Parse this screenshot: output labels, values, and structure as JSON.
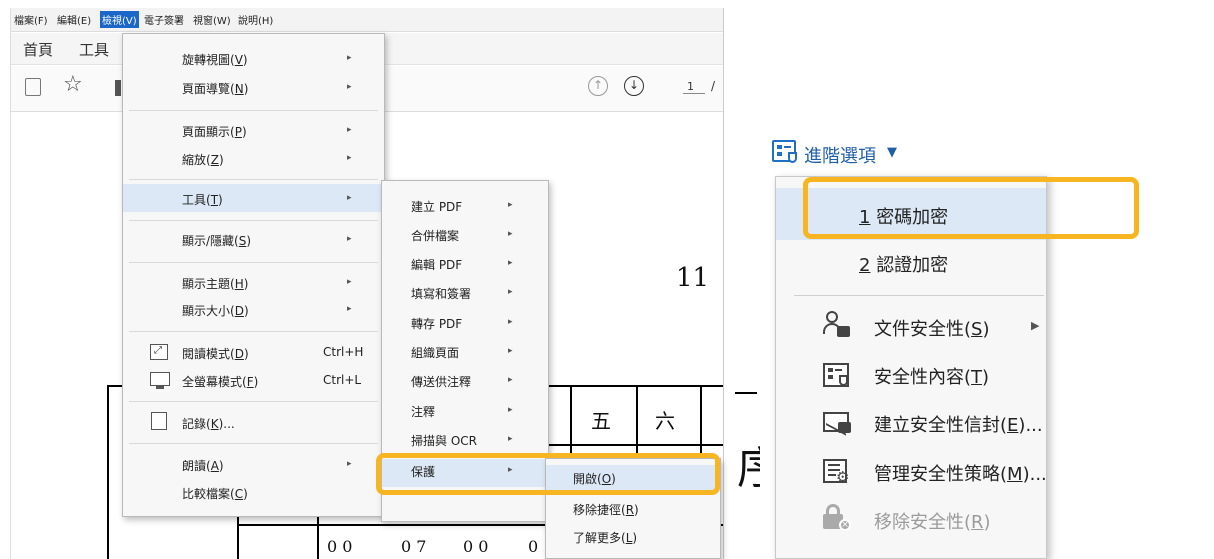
{
  "menubar": {
    "items": [
      "檔案(F)",
      "編輯(E)",
      "檢視(V)",
      "電子簽署",
      "視窗(W)",
      "說明(H)"
    ]
  },
  "tabs": {
    "home": "首頁",
    "tools": "工具"
  },
  "toolbar": {
    "page_number": "1",
    "page_sep": "/"
  },
  "document": {
    "title_fragment": "11",
    "cells": [
      "五",
      "六"
    ],
    "side_char": "序",
    "bottom_nums": [
      "0 0",
      "0 7",
      "0 0",
      "0"
    ]
  },
  "view_menu": {
    "items": [
      {
        "label": "旋轉視圖",
        "key": "V",
        "submenu": true
      },
      {
        "label": "頁面導覽",
        "key": "N",
        "submenu": true
      },
      {
        "label": "頁面顯示",
        "key": "P",
        "submenu": true
      },
      {
        "label": "縮放",
        "key": "Z",
        "submenu": true
      },
      {
        "label": "工具",
        "key": "T",
        "submenu": true
      },
      {
        "label": "顯示/隱藏",
        "key": "S",
        "submenu": true
      },
      {
        "label": "顯示主題",
        "key": "H",
        "submenu": true
      },
      {
        "label": "顯示大小",
        "key": "D",
        "submenu": true
      },
      {
        "label": "閱讀模式",
        "key": "D",
        "shortcut": "Ctrl+H"
      },
      {
        "label": "全螢幕模式",
        "key": "F",
        "shortcut": "Ctrl+L"
      },
      {
        "label": "記錄",
        "key": "K",
        "suffix": "..."
      },
      {
        "label": "朗讀",
        "key": "A",
        "submenu": true
      },
      {
        "label": "比較檔案",
        "key": "C"
      }
    ]
  },
  "tools_submenu": {
    "items": [
      "建立 PDF",
      "合併檔案",
      "編輯 PDF",
      "填寫和簽署",
      "轉存 PDF",
      "組織頁面",
      "傳送供注釋",
      "注釋",
      "掃描與 OCR",
      "保護"
    ]
  },
  "protect_submenu": {
    "items": [
      {
        "label": "開啟",
        "key": "O"
      },
      {
        "label": "移除捷徑",
        "key": "R"
      },
      {
        "label": "了解更多",
        "key": "L"
      }
    ]
  },
  "advanced_panel": {
    "header": "進階選項",
    "items": [
      {
        "num": "1",
        "label": "密碼加密"
      },
      {
        "num": "2",
        "label": "認證加密"
      },
      {
        "label": "文件安全性",
        "key": "S",
        "submenu": true
      },
      {
        "label": "安全性內容",
        "key": "T"
      },
      {
        "label": "建立安全性信封",
        "key": "E",
        "suffix": "..."
      },
      {
        "label": "管理安全性策略",
        "key": "M",
        "suffix": "..."
      },
      {
        "label": "移除安全性",
        "key": "R",
        "disabled": true
      }
    ]
  },
  "colors": {
    "highlight": "#f7b521",
    "active_menu": "#1a66c9",
    "row_hover": "#dde8f6",
    "icon_blue": "#1f6fc2"
  }
}
